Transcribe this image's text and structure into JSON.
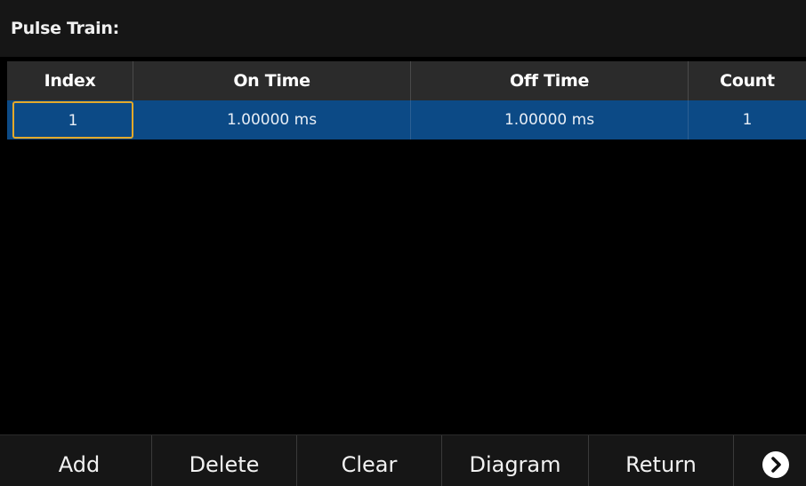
{
  "header": {
    "title": "Pulse Train:"
  },
  "table": {
    "columns": [
      "Index",
      "On Time",
      "Off Time",
      "Count"
    ],
    "rows": [
      {
        "index": "1",
        "on_time": "1.00000 ms",
        "off_time": "1.00000 ms",
        "count": "1"
      }
    ],
    "selected_cell": "Index"
  },
  "softkeys": {
    "add": "Add",
    "delete": "Delete",
    "clear": "Clear",
    "diagram": "Diagram",
    "return": "Return",
    "next_icon": "chevron-right-circle-icon"
  },
  "colors": {
    "selected_row": "#0c4a86",
    "selection_border": "#e4a92a",
    "header_background": "#2b2b2b",
    "screen_background": "#000000"
  }
}
